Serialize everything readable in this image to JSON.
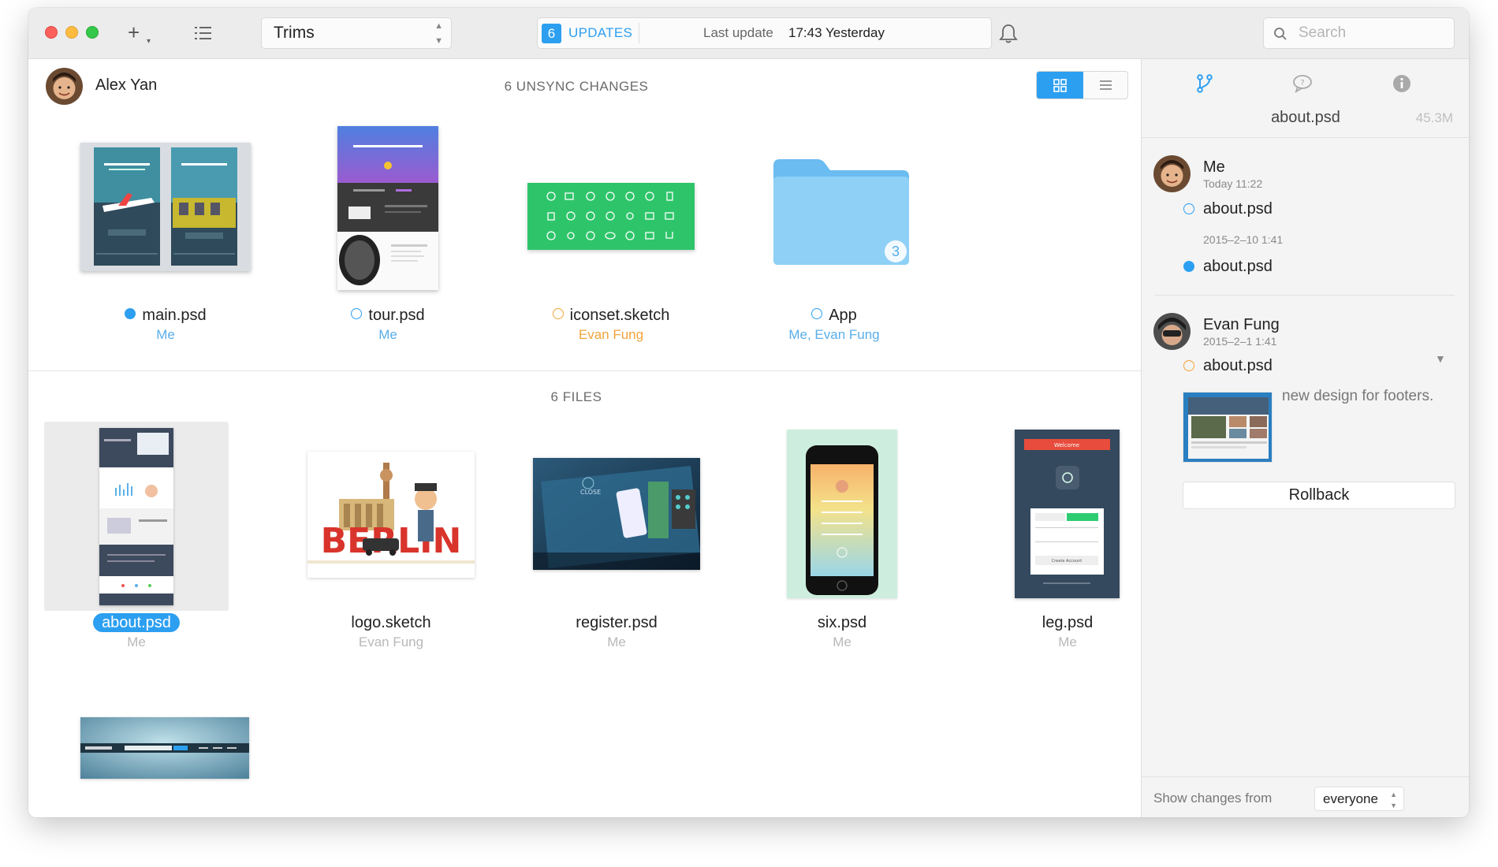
{
  "toolbar": {
    "project": "Trims",
    "updates_count": "6",
    "updates_label": "UPDATES",
    "last_update_label": "Last update",
    "last_update_time": "17:43 Yesterday",
    "search_placeholder": "Search"
  },
  "user": {
    "name": "Alex Yan"
  },
  "unsync": {
    "title": "6 UNSYNC CHANGES",
    "items": [
      {
        "name": "main.psd",
        "owner": "Me"
      },
      {
        "name": "tour.psd",
        "owner": "Me"
      },
      {
        "name": "iconset.sketch",
        "owner": "Evan Fung"
      },
      {
        "name": "App",
        "owner": "Me, Evan Fung",
        "badge": "3"
      }
    ]
  },
  "files": {
    "title": "6 FILES",
    "items": [
      {
        "name": "about.psd",
        "owner": "Me"
      },
      {
        "name": "logo.sketch",
        "owner": "Evan Fung",
        "art_text": "BERLIN"
      },
      {
        "name": "register.psd",
        "owner": "Me",
        "art_text": "CLOSE"
      },
      {
        "name": "six.psd",
        "owner": "Me"
      },
      {
        "name": "leg.psd",
        "owner": "Me",
        "art_title": "Welcome",
        "art_button": "Create Account"
      },
      {
        "name": "",
        "owner": ""
      }
    ]
  },
  "sidebar": {
    "file": "about.psd",
    "size": "45.3M",
    "history": [
      {
        "name": "Me",
        "date": "Today 11:22",
        "file": "about.psd",
        "sub_date": "2015–2–10 1:41",
        "sub_file": "about.psd"
      },
      {
        "name": "Evan Fung",
        "date": "2015–2–1 1:41",
        "file": "about.psd",
        "comment": "new design for footers."
      }
    ],
    "rollback_label": "Rollback",
    "footer_label": "Show changes from",
    "footer_value": "everyone"
  },
  "colors": {
    "accent": "#2c9ff1",
    "orange": "#f3a33c",
    "green_thumb": "#2ec56a",
    "folder": "#7fc8f3"
  }
}
